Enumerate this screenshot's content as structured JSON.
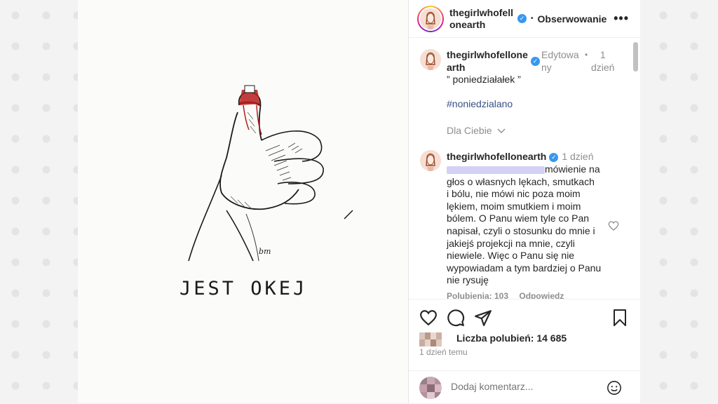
{
  "post": {
    "image": {
      "drawn_text": "JEST OKEJ",
      "signature": "bm",
      "colors": {
        "paper": "#fbfbf9",
        "ink": "#1a1a1a",
        "blood": "#b51d1d"
      }
    },
    "header": {
      "username_line1": "thegirlwhofell",
      "username_line2": "onearth",
      "separator": "•",
      "follow_label": "Obserwowanie",
      "more_icon": "more-horizontal-icon"
    },
    "caption": {
      "username_line1": "thegirlwhofellone",
      "username_line2": "arth",
      "edited_line1": "Edytowa",
      "edited_line2": "ny",
      "separator": "•",
      "time_line1": "1",
      "time_line2": "dzień",
      "text": "” poniedziałałek ”",
      "hashtag": "#noniedzialano",
      "for_you_label": "Dla Ciebie"
    },
    "comment": {
      "username": "thegirlwhofellonearth",
      "time": "1 dzień",
      "first_line_after_blur": "mówienie na",
      "lines": [
        "głos o własnych lękach, smutkach",
        "i bólu, nie mówi nic poza moim",
        "lękiem, moim smutkiem i moim",
        "bólem. O Panu wiem tyle co Pan",
        "napisał, czyli o stosunku do mnie i",
        "jakiejś projekcji na mnie, czyli",
        "niewiele. Więc o Panu się nie",
        "wypowiadam a tym bardziej o Panu",
        "nie rysuję"
      ],
      "meta_likes": "Polubienia: 103",
      "meta_reply": "Odpowiedz"
    },
    "likes": {
      "label": "Liczba polubień: 14 685",
      "posted": "1 dzień temu"
    },
    "add_comment": {
      "placeholder": "Dodaj komentarz...",
      "emoji_icon": "smile-icon"
    },
    "colors": {
      "verified": "#3897f0",
      "link": "#385185",
      "text": "#262626",
      "muted": "#8e8e8e"
    }
  }
}
